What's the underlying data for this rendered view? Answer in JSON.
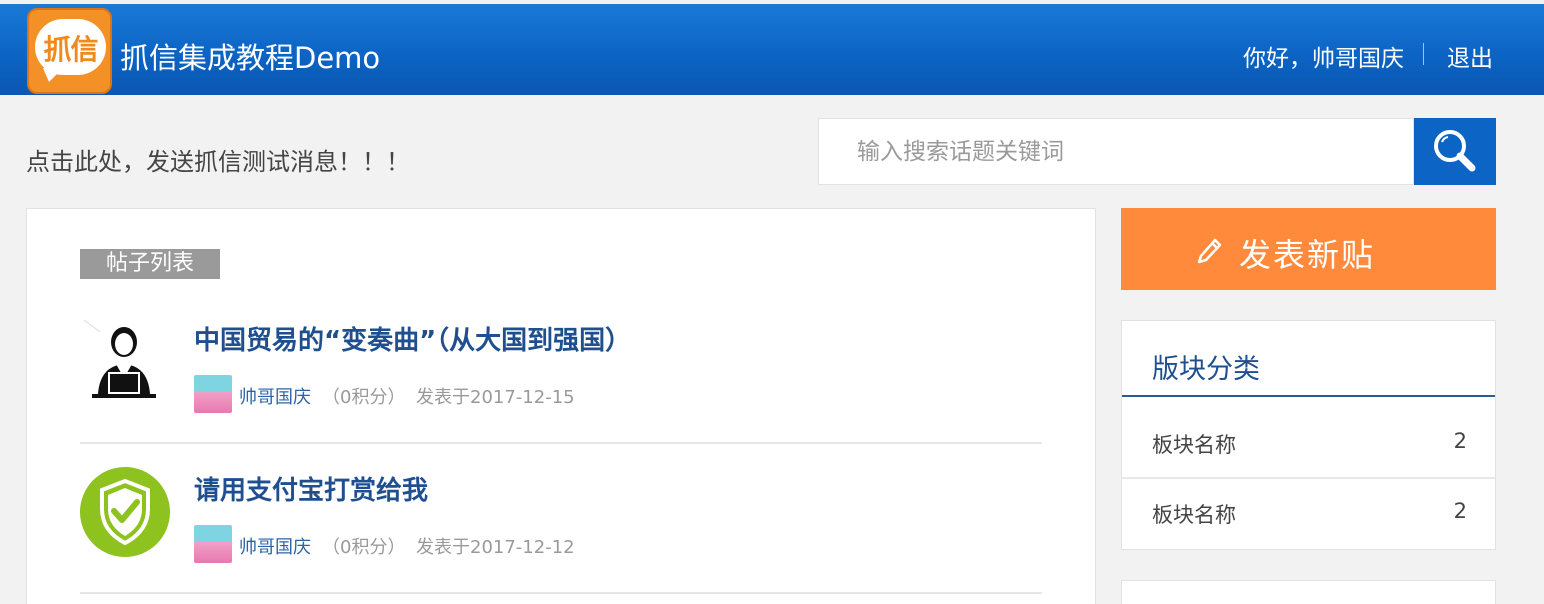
{
  "header": {
    "logo_text": "抓信",
    "site_title": "抓信集成教程Demo",
    "greeting": "你好，帅哥国庆",
    "logout": "退出"
  },
  "notice": {
    "link_text": "点击此处，发送抓信测试消息！！！"
  },
  "search": {
    "placeholder": "输入搜索话题关键词",
    "value": ""
  },
  "post_list": {
    "section_label": "帖子列表",
    "posts": [
      {
        "avatar_icon": "person-at-laptop-icon",
        "title": "中国贸易的“变奏曲”（从大国到强国）",
        "author": "帅哥国庆",
        "points": "（0积分）",
        "date": "发表于2017-12-15"
      },
      {
        "avatar_icon": "shield-check-icon",
        "title": "请用支付宝打赏给我",
        "author": "帅哥国庆",
        "points": "（0积分）",
        "date": "发表于2017-12-12"
      }
    ]
  },
  "sidebar": {
    "new_post_label": "发表新贴",
    "board": {
      "title": "版块分类",
      "items": [
        {
          "name": "板块名称",
          "count": "2"
        },
        {
          "name": "板块名称",
          "count": "2"
        }
      ]
    }
  },
  "colors": {
    "header_blue": "#0c64c4",
    "accent_orange": "#ff8a3c",
    "title_blue": "#1f4f8f",
    "shield_green": "#8dc21f"
  }
}
